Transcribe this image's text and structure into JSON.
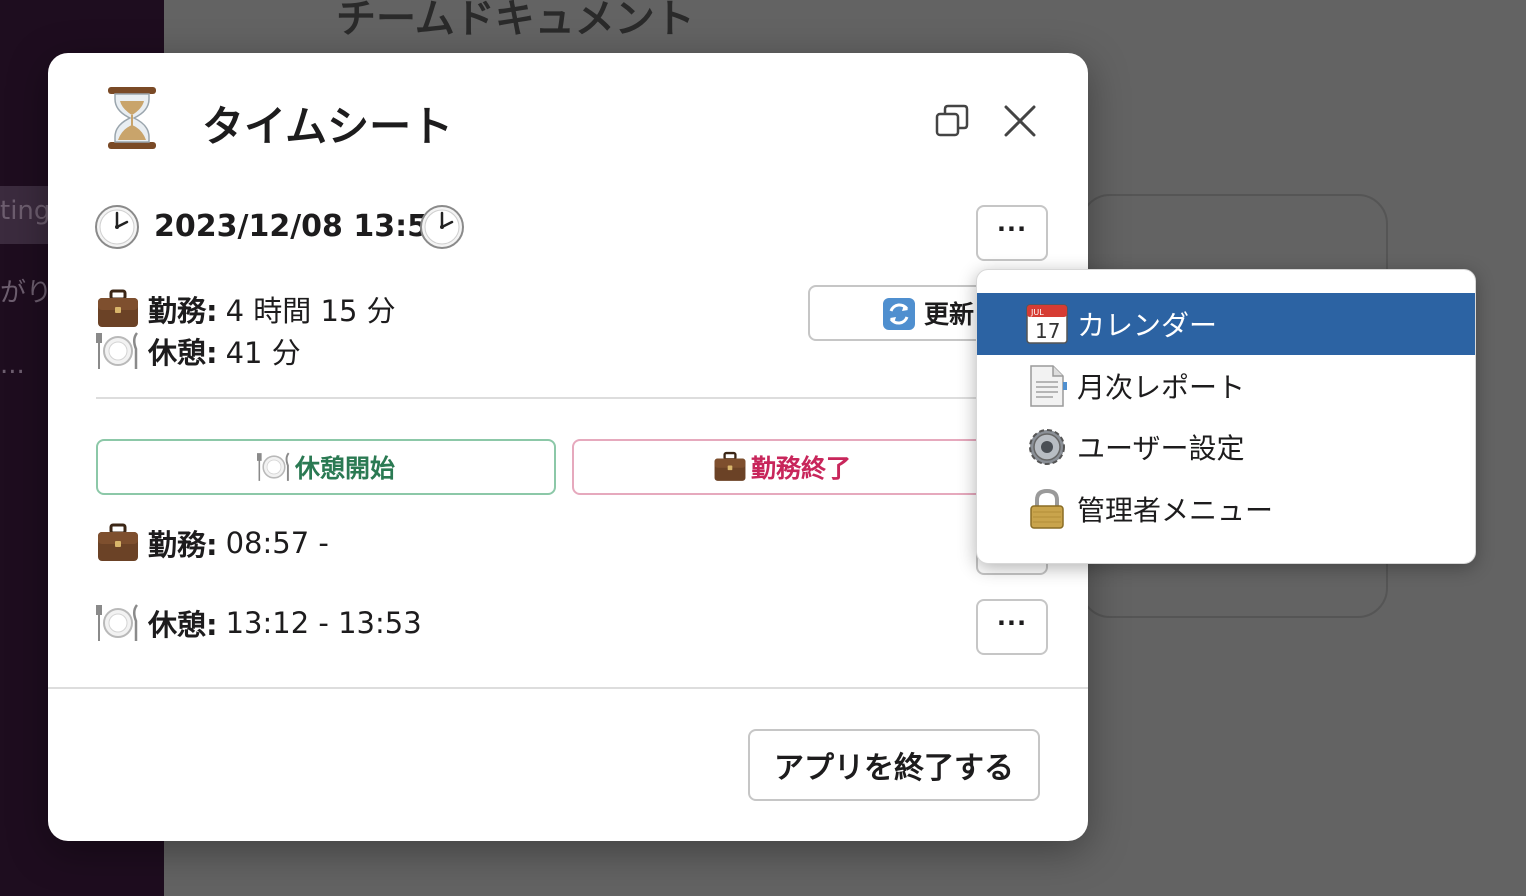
{
  "background": {
    "title": "チームドキュメント",
    "sidebar_fragments": [
      "ting",
      "がり",
      "..."
    ]
  },
  "modal": {
    "title": "タイムシート",
    "icons": {
      "app": "hourglass-icon",
      "copy": "copy-window-icon",
      "close": "close-icon"
    }
  },
  "datetime": "2023/12/08 13:53",
  "summary": {
    "work_label": "勤務:",
    "work_value": "4 時間 15 分",
    "break_label": "休憩:",
    "break_value": "41 分"
  },
  "buttons": {
    "refresh": "更新",
    "more": "···",
    "start_break": "休憩開始",
    "end_work": "勤務終了",
    "quit": "アプリを終了する"
  },
  "entries": [
    {
      "label": "勤務:",
      "value": "08:57 -"
    },
    {
      "label": "休憩:",
      "value": "13:12 - 13:53"
    }
  ],
  "menu": {
    "items": [
      {
        "label": "カレンダー",
        "icon": "calendar-icon",
        "selected": true
      },
      {
        "label": "月次レポート",
        "icon": "report-document-icon",
        "selected": false
      },
      {
        "label": "ユーザー設定",
        "icon": "gear-icon",
        "selected": false
      },
      {
        "label": "管理者メニュー",
        "icon": "lock-icon",
        "selected": false
      }
    ]
  },
  "colors": {
    "break_accent": "#2b7a53",
    "end_accent": "#c8265b",
    "menu_selection": "#2c63a3"
  },
  "calendar_icon": {
    "month": "JUL",
    "day": "17"
  }
}
